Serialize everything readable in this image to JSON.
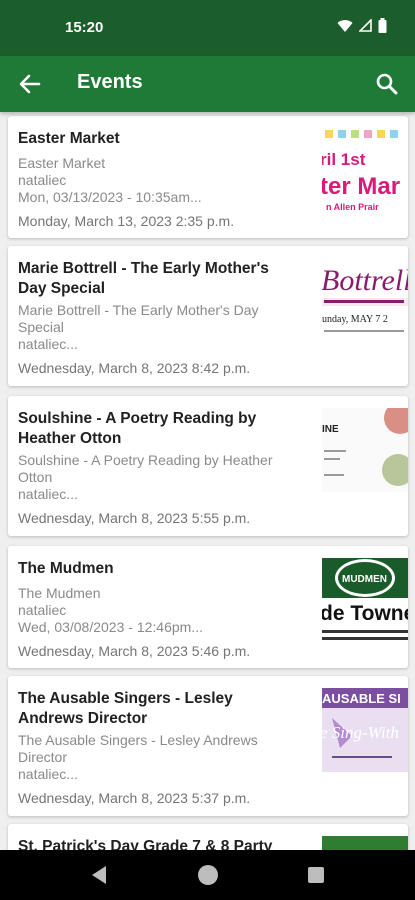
{
  "status_bar": {
    "time": "15:20"
  },
  "app_bar": {
    "title": "Events"
  },
  "events": [
    {
      "title": "Easter Market",
      "lines": [
        "Easter Market",
        "nataliec",
        "Mon, 03/13/2023 - 10:35am..."
      ],
      "date": "Monday, March 13, 2023 2:35 p.m.",
      "thumb_texts": [
        "ril 1st",
        "ter Mar",
        "n Allen Prair"
      ]
    },
    {
      "title": "Marie Bottrell - The Early Mother's Day Special",
      "lines": [
        "Marie Bottrell - The Early Mother's Day Special",
        "nataliec..."
      ],
      "date": "Wednesday, March 8, 2023 8:42 p.m.",
      "thumb_texts": [
        "Bottrell",
        "unday, MAY 7 2"
      ]
    },
    {
      "title": "Soulshine - A Poetry Reading by Heather Otton",
      "lines": [
        "Soulshine - A Poetry Reading by Heather Otton",
        "nataliec..."
      ],
      "date": "Wednesday, March 8, 2023 5:55 p.m.",
      "thumb_texts": [
        "INE"
      ]
    },
    {
      "title": "The Mudmen",
      "lines": [
        "The Mudmen",
        "nataliec",
        "Wed, 03/08/2023 - 12:46pm..."
      ],
      "date": "Wednesday, March 8, 2023 5:46 p.m.",
      "thumb_texts": [
        "MUDMEN",
        "de Towne"
      ]
    },
    {
      "title": "The Ausable Singers - Lesley Andrews Director",
      "lines": [
        "The Ausable Singers - Lesley Andrews Director",
        "nataliec..."
      ],
      "date": "Wednesday, March 8, 2023 5:37 p.m.",
      "thumb_texts": [
        "AUSABLE SI",
        "e Sing-With"
      ]
    },
    {
      "title": "St. Patrick's Day Grade 7 & 8 Party",
      "lines": [],
      "date": "",
      "thumb_texts": []
    }
  ]
}
